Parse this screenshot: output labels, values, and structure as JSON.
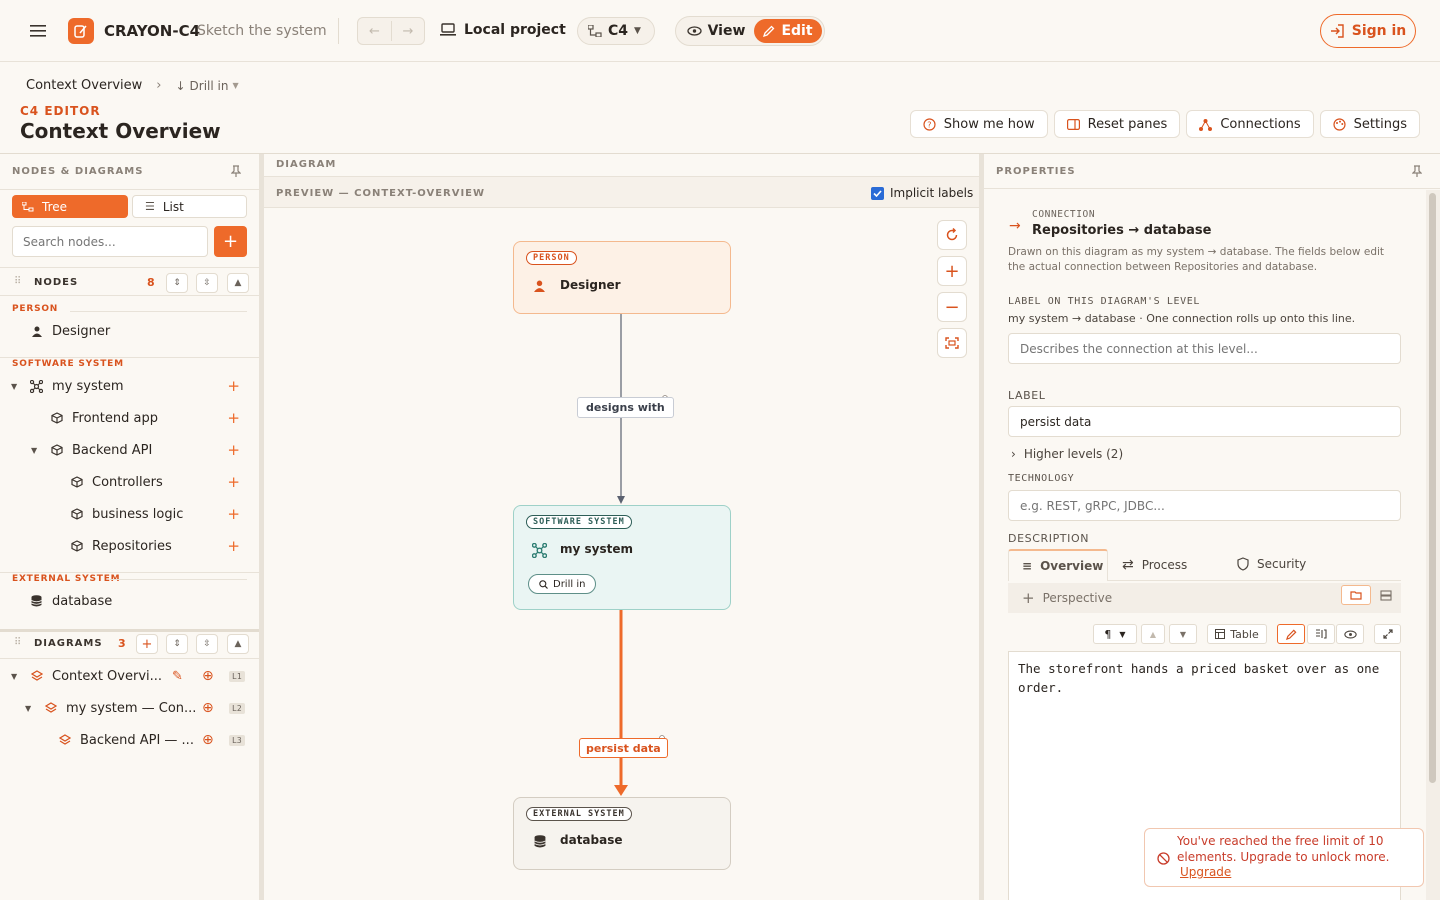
{
  "app": {
    "name": "CRAYON-C4",
    "tagline": "Sketch the system"
  },
  "topbar": {
    "project": "Local project",
    "notation": "C4",
    "view": "View",
    "edit": "Edit",
    "signin": "Sign in"
  },
  "header": {
    "breadcrumb": "Context Overview",
    "drill": "Drill in",
    "eyebrow": "C4 EDITOR",
    "title": "Context Overview",
    "actions": {
      "show": "Show me how",
      "reset": "Reset panes",
      "connections": "Connections",
      "settings": "Settings"
    }
  },
  "left": {
    "title": "NODES & DIAGRAMS",
    "tabs": {
      "tree": "Tree",
      "list": "List"
    },
    "search_placeholder": "Search nodes...",
    "nodes_label": "NODES",
    "nodes_count": "8",
    "cats": {
      "person": "PERSON",
      "software": "SOFTWARE SYSTEM",
      "external": "EXTERNAL SYSTEM"
    },
    "person": "Designer",
    "my_system": "my system",
    "frontend": "Frontend app",
    "backend": "Backend API",
    "controllers": "Controllers",
    "logic": "business logic",
    "repos": "Repositories",
    "database": "database",
    "diagrams_label": "DIAGRAMS",
    "diagrams_count": "3",
    "diagrams": [
      {
        "name": "Context Overvi...",
        "level": "L1"
      },
      {
        "name": "my system — Con...",
        "level": "L2"
      },
      {
        "name": "Backend API — ...",
        "level": "L3"
      }
    ]
  },
  "center": {
    "title": "DIAGRAM",
    "preview": "PREVIEW — CONTEXT-OVERVIEW",
    "implicit": "Implicit labels",
    "nodes": {
      "person_tag": "PERSON",
      "person": "Designer",
      "sys_tag": "SOFTWARE SYSTEM",
      "sys": "my system",
      "drill": "Drill in",
      "ext_tag": "EXTERNAL SYSTEM",
      "ext": "database"
    },
    "edges": {
      "e1": "designs with",
      "e2": "persist data"
    }
  },
  "right": {
    "title": "PROPERTIES",
    "kind": "CONNECTION",
    "name": "Repositories → database",
    "desc": "Drawn on this diagram as my system → database. The fields below edit the actual connection between Repositories and database.",
    "level_label": "LABEL ON THIS DIAGRAM'S LEVEL",
    "level_sub": "my system → database · One connection rolls up onto this line.",
    "level_placeholder": "Describes the connection at this level...",
    "label_label": "LABEL",
    "label_value": "persist data",
    "higher": "Higher levels (2)",
    "tech_label": "TECHNOLOGY",
    "tech_placeholder": "e.g. REST, gRPC, JDBC...",
    "desc_label": "DESCRIPTION",
    "tabs": {
      "overview": "Overview",
      "process": "Process",
      "security": "Security"
    },
    "perspective": "Perspective",
    "table": "Table",
    "text": "The storefront hands a priced basket over as one order."
  },
  "toast": {
    "message": "You've reached the free limit of 10 elements. Upgrade to unlock more.",
    "link": "Upgrade"
  },
  "colors": {
    "accent": "#ee6a2a",
    "bg": "#fbf8f3",
    "teal": "#eaf5f3"
  }
}
